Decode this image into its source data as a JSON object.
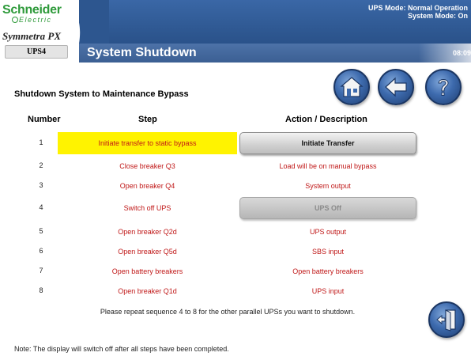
{
  "header": {
    "brand": "Schneider",
    "brand_sub": "Electric",
    "product": "Symmetra PX",
    "unit": "UPS4",
    "title": "System Shutdown",
    "ups_mode": "UPS Mode: Normal Operation",
    "system_mode": "System Mode: On",
    "clock": "08:09"
  },
  "nav": {
    "home_icon": "home-icon",
    "back_icon": "back-arrow-icon",
    "help_icon": "help-icon"
  },
  "section": {
    "title": "Shutdown System to Maintenance Bypass"
  },
  "table": {
    "headers": {
      "number": "Number",
      "step": "Step",
      "action": "Action / Description"
    },
    "rows": [
      {
        "number": "1",
        "step": "Initiate transfer to static bypass",
        "action": "Initiate Transfer",
        "highlight": true
      },
      {
        "number": "2",
        "step": "Close breaker Q3",
        "action": "Load will be on manual bypass"
      },
      {
        "number": "3",
        "step": "Open breaker Q4",
        "action": "System output"
      },
      {
        "number": "4",
        "step": "Switch off UPS",
        "action": "UPS Off"
      },
      {
        "number": "5",
        "step": "Open breaker Q2d",
        "action": "UPS output"
      },
      {
        "number": "6",
        "step": "Open breaker Q5d",
        "action": "SBS input"
      },
      {
        "number": "7",
        "step": "Open battery breakers",
        "action": "Open battery breakers"
      },
      {
        "number": "8",
        "step": "Open breaker Q1d",
        "action": "UPS input"
      }
    ]
  },
  "notes": {
    "repeat": "Please repeat sequence 4 to 8 for the other parallel UPSs you want to shutdown.",
    "footer": "Note: The display will switch off after all steps have been completed."
  },
  "colors": {
    "brand_green": "#2e9a3a",
    "header_blue": "#2d568f",
    "highlight_yellow": "#fff300",
    "step_red": "#c01818"
  },
  "exit": {
    "icon": "exit-door-icon"
  }
}
